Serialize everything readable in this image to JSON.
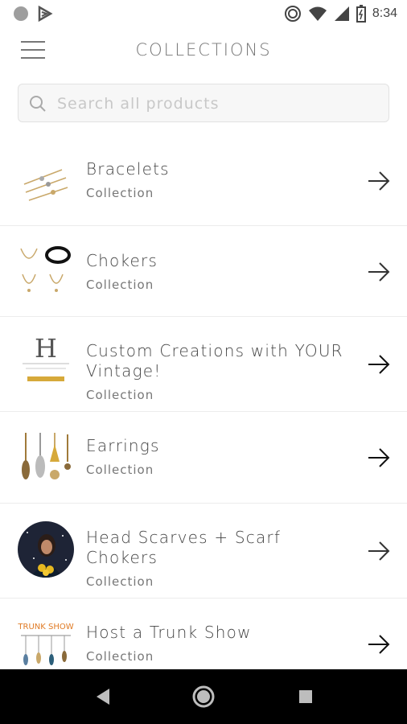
{
  "status_bar": {
    "time": "8:34",
    "icons": [
      "circle-notification-icon",
      "play-store-icon",
      "do-not-disturb-icon",
      "wifi-icon",
      "cell-signal-icon",
      "battery-icon"
    ]
  },
  "header": {
    "title": "COLLECTIONS",
    "menu_icon": "hamburger-menu-icon"
  },
  "search": {
    "placeholder": "Search all products"
  },
  "collections": [
    {
      "name": "Bracelets",
      "subtitle": "Collection"
    },
    {
      "name": "Chokers",
      "subtitle": "Collection"
    },
    {
      "name": "Custom Creations with YOUR Vintage!",
      "subtitle": "Collection"
    },
    {
      "name": "Earrings",
      "subtitle": "Collection"
    },
    {
      "name": "Head Scarves + Scarf Chokers",
      "subtitle": "Collection"
    },
    {
      "name": "Host a Trunk Show",
      "subtitle": "Collection"
    }
  ],
  "thumbnail_text": {
    "custom_letter": "H",
    "trunk_show": "TRUNK SHOW"
  },
  "nav_bar": {
    "icons": [
      "back-icon",
      "home-icon",
      "recents-icon"
    ]
  },
  "colors": {
    "title": "#777777",
    "text": "#444444",
    "subtitle": "#777777",
    "divider": "#ececec",
    "navbar": "#000000"
  }
}
